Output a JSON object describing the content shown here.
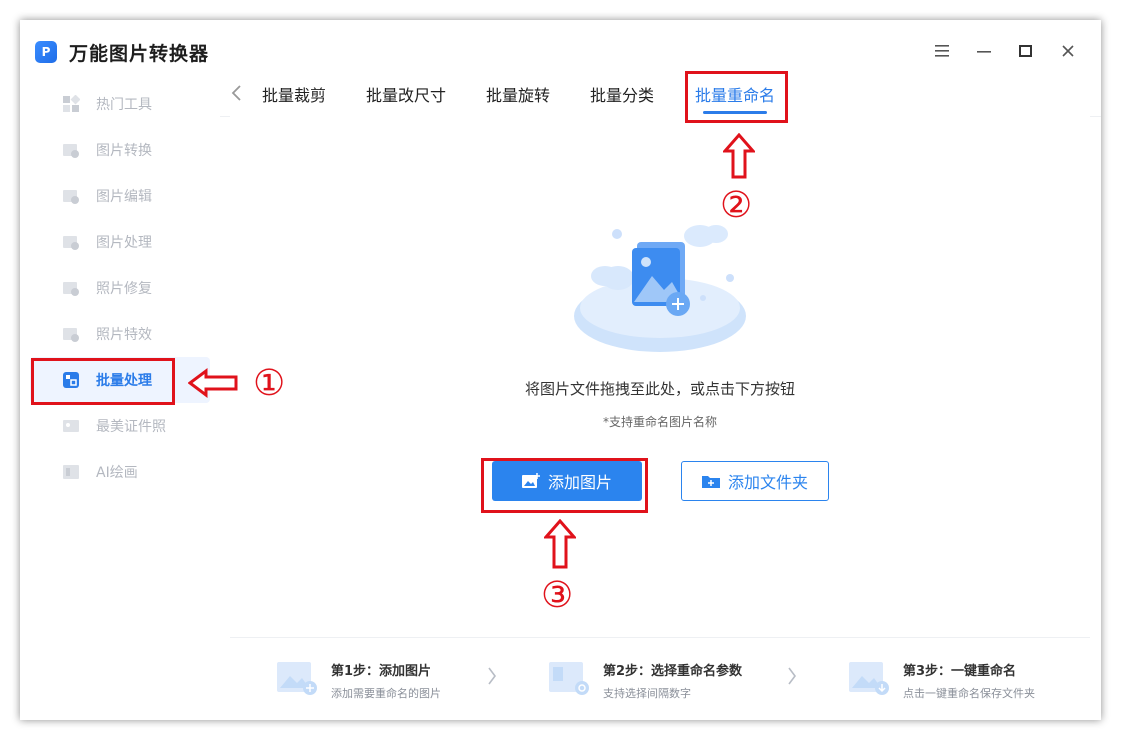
{
  "app": {
    "title": "万能图片转换器",
    "logo_glyph": "P"
  },
  "window_controls": [
    "menu-icon",
    "minimize-icon",
    "maximize-icon",
    "close-icon"
  ],
  "sidebar": {
    "items": [
      {
        "label": "热门工具",
        "icon": "grid-icon"
      },
      {
        "label": "图片转换",
        "icon": "image-convert-icon"
      },
      {
        "label": "图片编辑",
        "icon": "image-edit-icon"
      },
      {
        "label": "图片处理",
        "icon": "image-process-icon"
      },
      {
        "label": "照片修复",
        "icon": "photo-repair-icon"
      },
      {
        "label": "照片特效",
        "icon": "photo-effect-icon"
      },
      {
        "label": "批量处理",
        "icon": "batch-icon",
        "active": true
      },
      {
        "label": "最美证件照",
        "icon": "id-photo-icon"
      },
      {
        "label": "AI绘画",
        "icon": "ai-paint-icon"
      }
    ]
  },
  "tabs": {
    "items": [
      {
        "label": "批量裁剪"
      },
      {
        "label": "批量改尺寸"
      },
      {
        "label": "批量旋转"
      },
      {
        "label": "批量分类"
      },
      {
        "label": "批量重命名",
        "active": true
      }
    ]
  },
  "dropzone": {
    "text": "将图片文件拖拽至此处，或点击下方按钮",
    "subtext": "*支持重命名图片名称"
  },
  "buttons": {
    "add_image": "添加图片",
    "add_folder": "添加文件夹"
  },
  "steps": [
    {
      "title": "第1步：添加图片",
      "desc": "添加需要重命名的图片"
    },
    {
      "title": "第2步：选择重命名参数",
      "desc": "支持选择间隔数字"
    },
    {
      "title": "第3步：一键重命名",
      "desc": "点击一键重命名保存文件夹"
    }
  ],
  "annotations": {
    "one": "①",
    "two": "②",
    "three": "③"
  },
  "colors": {
    "accent": "#2b7ce9",
    "annotation": "#e0121b"
  }
}
